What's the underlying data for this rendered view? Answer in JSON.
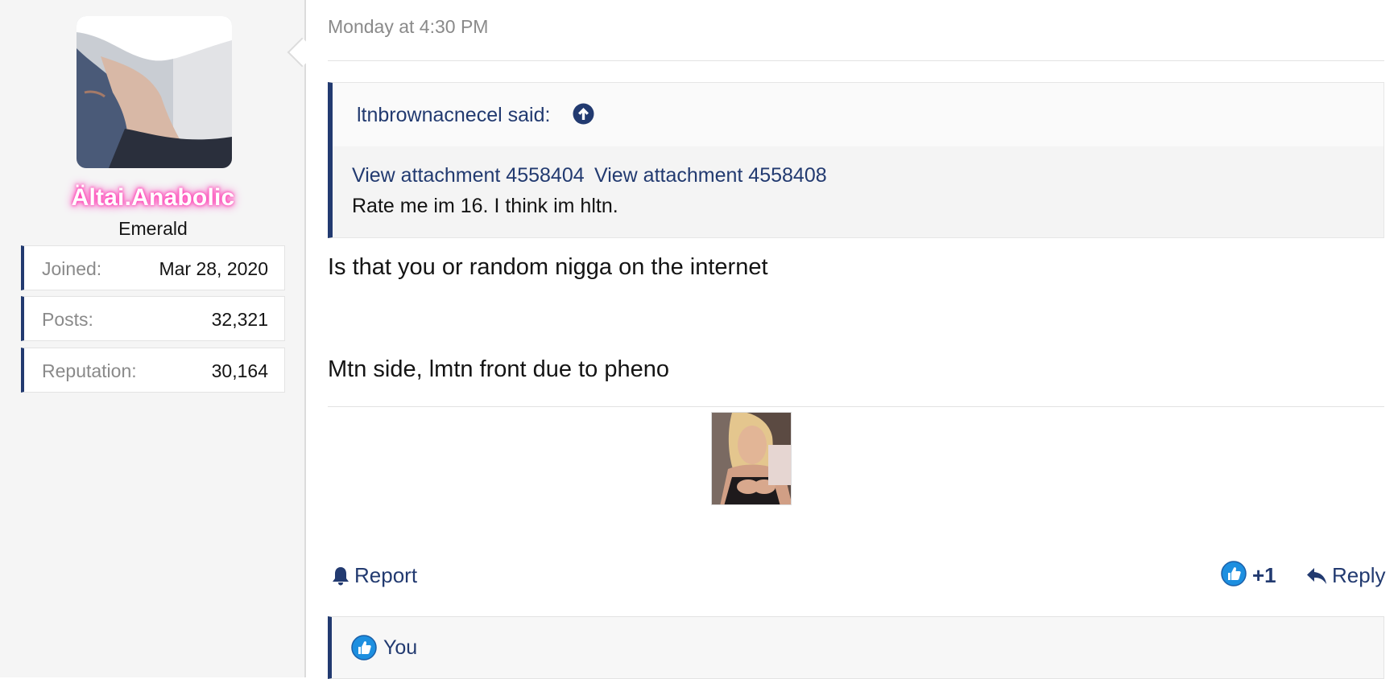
{
  "author": {
    "username": "Ältai.Anabolic",
    "user_title": "Emerald",
    "avatar_icon": "avatar-photo",
    "stats": [
      {
        "label": "Joined:",
        "value": "Mar 28, 2020"
      },
      {
        "label": "Posts:",
        "value": "32,321"
      },
      {
        "label": "Reputation:",
        "value": "30,164"
      }
    ]
  },
  "post": {
    "timestamp": "Monday at 4:30 PM",
    "quote": {
      "author_said": "ltnbrownacnecel said:",
      "attachments": [
        "View attachment 4558404",
        "View attachment 4558408"
      ],
      "text": "Rate me im 16. I think im hltn."
    },
    "body_lines": [
      "Is that you or random nigga on the internet",
      "Mtn side, lmtn front due to pheno"
    ],
    "signature_image": "signature-photo"
  },
  "actions": {
    "report_label": "Report",
    "like_count": "+1",
    "reply_label": "Reply"
  },
  "reactions": {
    "users": "You"
  },
  "colors": {
    "accent": "#223a70",
    "like_blue": "#1d8fe0",
    "username_glow": "#ff3fb3",
    "sidebar_bg": "#f5f5f5"
  }
}
